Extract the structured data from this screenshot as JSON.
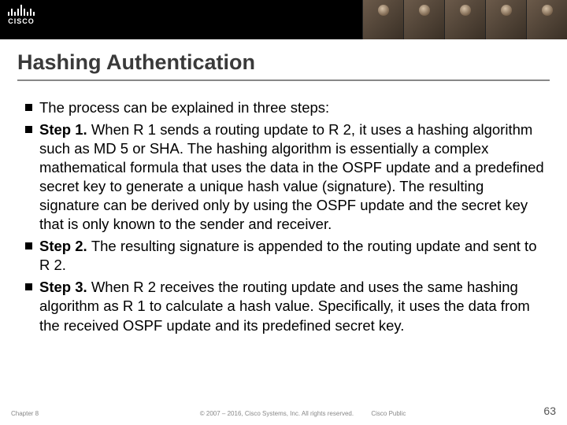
{
  "header": {
    "logo_text": "CISCO"
  },
  "title": "Hashing Authentication",
  "bullets": [
    {
      "lead": "",
      "text": "The process can be explained in three steps:"
    },
    {
      "lead": "Step 1. ",
      "text": "When R 1 sends a routing update to R 2, it uses a hashing algorithm such as MD 5 or SHA. The hashing algorithm is essentially a complex mathematical formula that uses the data in the OSPF update and a predefined secret key to generate a unique hash value (signature). The resulting signature can be derived only by using the OSPF update and the secret key that is only known to the sender and receiver."
    },
    {
      "lead": "Step 2. ",
      "text": "The resulting signature is appended to the routing update and sent to R 2."
    },
    {
      "lead": "Step 3. ",
      "text": "When R 2 receives the routing update and uses the same hashing algorithm as R 1 to calculate a hash value. Specifically, it uses the data from the received OSPF update and its predefined secret key."
    }
  ],
  "footer": {
    "chapter": "Chapter 8",
    "copyright": "© 2007 – 2016, Cisco Systems, Inc. All rights reserved.",
    "public": "Cisco Public",
    "page": "63"
  }
}
